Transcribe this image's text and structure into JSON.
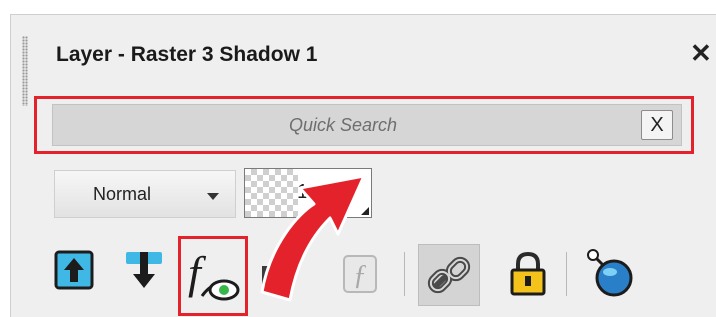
{
  "panel": {
    "title": "Layer - Raster 3 Shadow 1",
    "close_label": "✕"
  },
  "search": {
    "placeholder": "Quick Search",
    "value": "",
    "clear_label": "X"
  },
  "blend_mode": {
    "selected": "Normal"
  },
  "opacity": {
    "value": "1"
  },
  "toolbar": {
    "icons": [
      "move-up-icon",
      "move-down-icon",
      "layer-styles-icon",
      "mask-icon",
      "function-icon",
      "link-icon",
      "lock-icon",
      "visibility-toggle-icon"
    ]
  },
  "colors": {
    "highlight": "#e4222b",
    "panel_bg": "#efefef",
    "arrow_blue": "#4cc3ea"
  }
}
